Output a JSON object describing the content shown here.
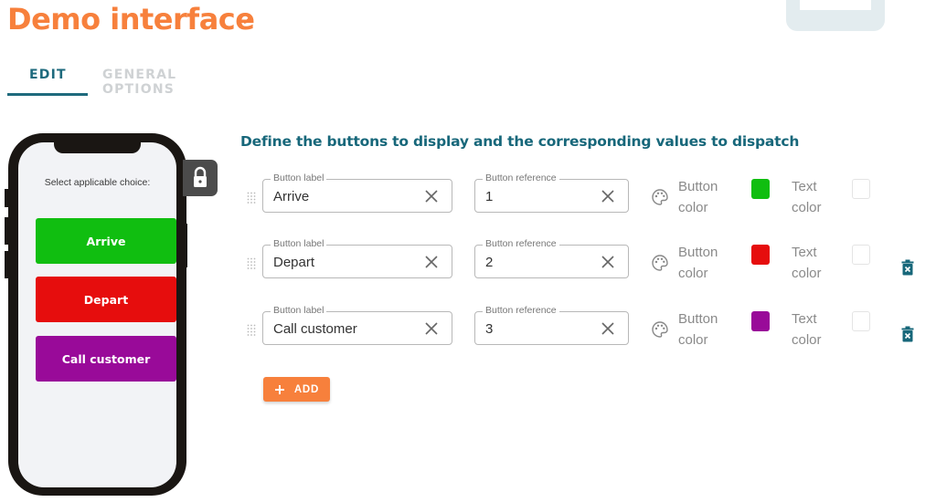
{
  "header": {
    "title": "Demo interface",
    "title_color": "#f7803c"
  },
  "tabs": [
    {
      "label": "EDIT",
      "active": true
    },
    {
      "label": "GENERAL OPTIONS",
      "active": false
    }
  ],
  "preview": {
    "prompt": "Select applicable choice:",
    "buttons": [
      {
        "label": "Arrive",
        "color": "#10be10"
      },
      {
        "label": "Depart",
        "color": "#e60d0d"
      },
      {
        "label": "Call customer",
        "color": "#990a99"
      }
    ]
  },
  "editor": {
    "heading": "Define the buttons to display and the corresponding values to dispatch",
    "label_field_label": "Button label",
    "reference_field_label": "Button reference",
    "button_color_label_1": "Button",
    "button_color_label_2": "color",
    "text_color_label_1": "Text",
    "text_color_label_2": "color",
    "rows": [
      {
        "label": "Arrive",
        "reference": "1",
        "button_color": "#10be10",
        "text_color": "#ffffff",
        "deletable": false
      },
      {
        "label": "Depart",
        "reference": "2",
        "button_color": "#e60d0d",
        "text_color": "#ffffff",
        "deletable": true
      },
      {
        "label": "Call customer",
        "reference": "3",
        "button_color": "#990a99",
        "text_color": "#ffffff",
        "deletable": true
      }
    ],
    "add_label": "ADD"
  },
  "icons": {
    "edit": "pencil-icon",
    "lock": "lock-icon",
    "drag": "drag-handle-icon",
    "clear": "close-icon",
    "palette": "palette-icon",
    "delete": "trash-icon",
    "add": "plus-icon"
  }
}
